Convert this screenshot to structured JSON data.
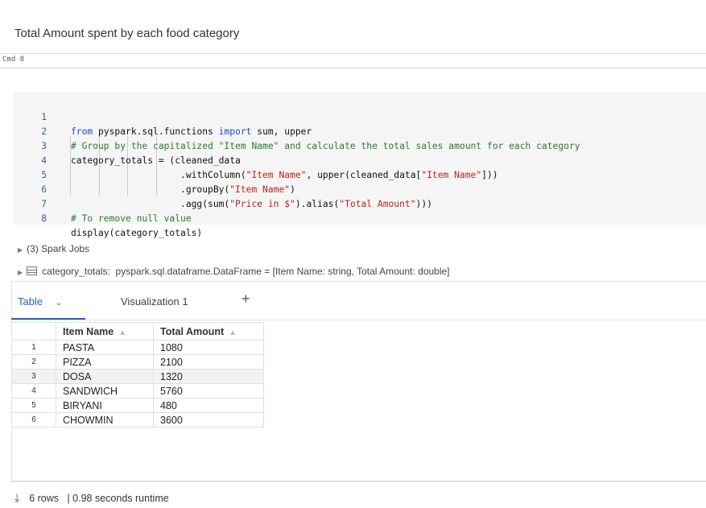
{
  "markdown": {
    "title": "Total Amount spent by each food category"
  },
  "cmd": {
    "label": "Cmd 8"
  },
  "code": {
    "lines": [
      {
        "num": "1"
      },
      {
        "num": "2"
      },
      {
        "num": "3"
      },
      {
        "num": "4"
      },
      {
        "num": "5"
      },
      {
        "num": "6"
      },
      {
        "num": "7"
      },
      {
        "num": "8"
      }
    ]
  },
  "output": {
    "spark_jobs": "(3) Spark Jobs",
    "df_name": "category_totals:",
    "df_type": "pyspark.sql.dataframe.DataFrame = [Item Name: string, Total Amount: double]"
  },
  "tabs": {
    "table": "Table",
    "visualization": "Visualization 1",
    "add": "+"
  },
  "table": {
    "columns": [
      "Item Name",
      "Total Amount"
    ],
    "rows": [
      {
        "idx": "1",
        "name": "PASTA",
        "amount": "1080"
      },
      {
        "idx": "2",
        "name": "PIZZA",
        "amount": "2100"
      },
      {
        "idx": "3",
        "name": "DOSA",
        "amount": "1320"
      },
      {
        "idx": "4",
        "name": "SANDWICH",
        "amount": "5760"
      },
      {
        "idx": "5",
        "name": "BIRYANI",
        "amount": "480"
      },
      {
        "idx": "6",
        "name": "CHOWMIN",
        "amount": "3600"
      }
    ]
  },
  "footer": {
    "rows": "6 rows",
    "runtime": "| 0.98 seconds runtime"
  },
  "colors": {
    "accent": "#1f63c9",
    "keyword": "#1a4ec9",
    "string": "#b8231d",
    "comment": "#2b7a2b"
  }
}
